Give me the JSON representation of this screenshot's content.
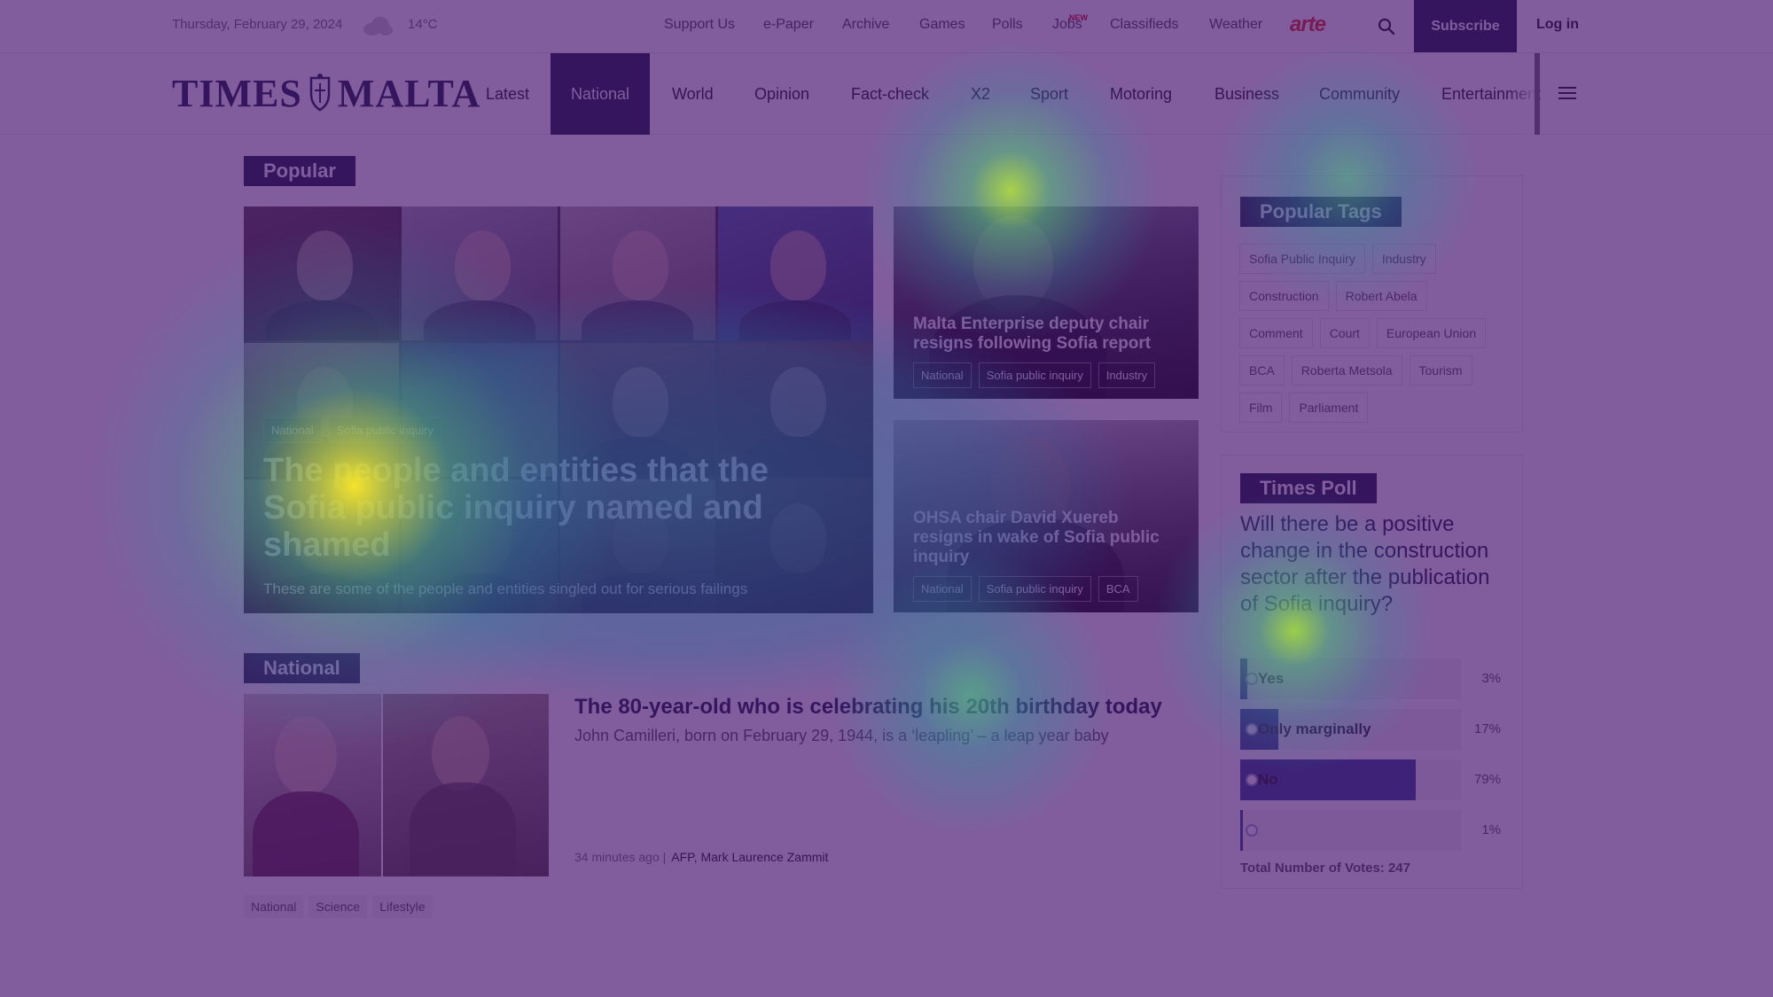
{
  "topbar": {
    "date": "Thursday, February 29, 2024",
    "weather_icon": "cloud-icon",
    "temperature": "14°C",
    "links": [
      "Support Us",
      "e-Paper",
      "Archive",
      "Games",
      "Polls",
      "Jobs",
      "Classifieds",
      "Weather"
    ],
    "jobs_badge": "NEW",
    "partner_logo": "arte",
    "search_icon": "search-icon",
    "subscribe_label": "Subscribe",
    "login_label": "Log in"
  },
  "nav": {
    "logo_text": "TIMES MALTA",
    "logo_left": "TIMES",
    "logo_right": "MALTA",
    "items": [
      "Latest",
      "National",
      "World",
      "Opinion",
      "Fact-check",
      "X2",
      "Sport",
      "Motoring",
      "Business",
      "Community",
      "Entertainment"
    ],
    "active_item": "National",
    "menu_icon": "hamburger-menu-icon"
  },
  "popular": {
    "heading": "Popular",
    "main_story": {
      "tags": [
        "National",
        "Sofia public inquiry"
      ],
      "title": "The people and entities that the Sofia public inquiry named and shamed",
      "subtitle": "These are some of the people and entities singled out for serious failings"
    },
    "side_stories": [
      {
        "title": "Malta Enterprise deputy chair resigns following Sofia report",
        "tags": [
          "National",
          "Sofia public inquiry",
          "Industry"
        ]
      },
      {
        "title": "OHSA chair David Xuereb resigns in wake of Sofia public inquiry",
        "tags": [
          "National",
          "Sofia public inquiry",
          "BCA"
        ]
      }
    ]
  },
  "national": {
    "heading": "National",
    "story": {
      "title": "The 80-year-old who is celebrating his 20th birthday today",
      "subtitle": "John Camilleri, born on February 29, 1944, is a ‘leapling’ – a leap year baby",
      "time": "34 minutes ago |",
      "authors": "AFP, Mark Laurence Zammit",
      "tags": [
        "National",
        "Science",
        "Lifestyle"
      ]
    }
  },
  "popular_tags": {
    "heading": "Popular Tags",
    "tags": [
      "Sofia Public Inquiry",
      "Industry",
      "Construction",
      "Robert Abela",
      "Comment",
      "Court",
      "European Union",
      "BCA",
      "Roberta Metsola",
      "Tourism",
      "Film",
      "Parliament"
    ]
  },
  "poll": {
    "heading": "Times Poll",
    "question": "Will there be a positive change in the construction sector after the publication of Sofia inquiry?",
    "options": [
      {
        "label": "Yes",
        "percent": "3%",
        "share": 0.03
      },
      {
        "label": "Only marginally",
        "percent": "17%",
        "share": 0.17
      },
      {
        "label": "No",
        "percent": "79%",
        "share": 0.79
      },
      {
        "label": "",
        "percent": "1%",
        "share": 0.01
      }
    ],
    "total": "Total Number of Votes: 247"
  },
  "colors": {
    "brand_navy": "#15213b",
    "poll_fill": "#2d4a8a",
    "arte_red": "#e4321a",
    "heatmap_base": "#46106e"
  }
}
